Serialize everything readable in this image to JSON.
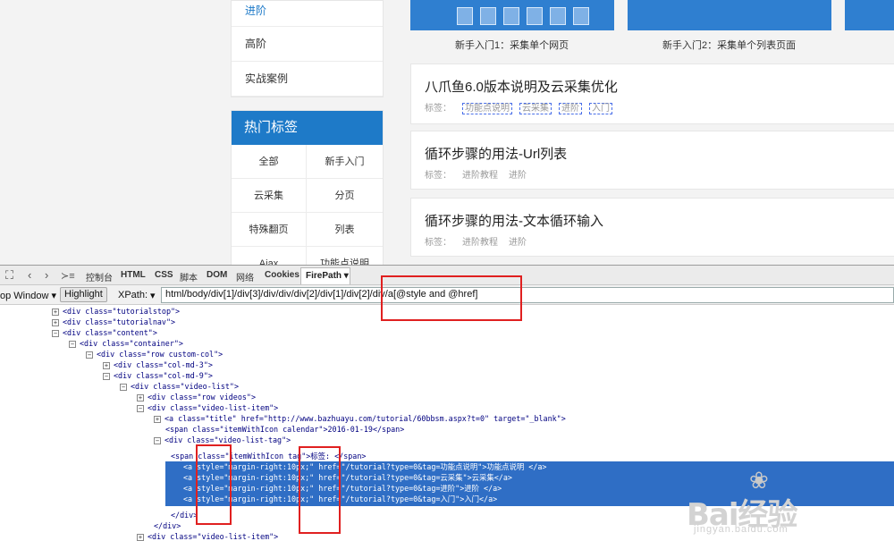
{
  "side_menu": {
    "items": [
      "进阶",
      "高阶",
      "实战案例"
    ]
  },
  "hot_tags": {
    "title": "热门标签",
    "items": [
      "全部",
      "新手入门",
      "云采集",
      "分页",
      "特殊翻页",
      "列表",
      "Ajax",
      "功能点说明"
    ]
  },
  "thumbnails": {
    "captions": [
      "新手入门1：采集单个网页",
      "新手入门2：采集单个列表页面"
    ]
  },
  "articles": [
    {
      "title": "八爪鱼6.0版本说明及云采集优化",
      "tag_label": "标签：",
      "tags": [
        "功能点说明",
        "云采集",
        "进阶",
        "入门"
      ]
    },
    {
      "title": "循环步骤的用法-Url列表",
      "tag_label": "标签：",
      "tags": [
        "进阶教程",
        "进阶"
      ]
    },
    {
      "title": "循环步骤的用法-文本循环输入",
      "tag_label": "标签：",
      "tags": [
        "进阶教程",
        "进阶"
      ]
    }
  ],
  "devtools": {
    "tabs": [
      "控制台",
      "HTML",
      "CSS",
      "脚本",
      "DOM",
      "网络",
      "Cookies"
    ],
    "active_tab": "FirePath ▾",
    "toolbar": {
      "window_select": "op Window ▾",
      "highlight_button": "Highlight",
      "xpath_label": "XPath:",
      "xpath_dropdown": "▾",
      "xpath_value": "html/body/div[1]/div[3]/div/div/div[2]/div[1]/div[2]/div/a[@style and @href]"
    },
    "tree_lines": [
      "<div class=\"tutorialstop\">",
      "<div class=\"tutorialnav\">",
      "<div class=\"content\">",
      "<div class=\"container\">",
      "<div class=\"row custom-col\">",
      "<div class=\"col-md-3\">",
      "<div class=\"col-md-9\">",
      "<div class=\"video-list\">",
      "<div class=\"row videos\">",
      "<div class=\"video-list-item\">",
      "<a class=\"title\" href=\"http://www.bazhuayu.com/tutorial/60bbsm.aspx?t=0\" target=\"_blank\">",
      "<span class=\"itemWithIcon calendar\">2016-01-19</span>",
      "<div class=\"video-list-tag\">",
      "<span class=\"itemWithIcon tag\">标签: </span>",
      "<a style=\"margin-right:10px;\" href=\"/tutorial?type=0&tag=功能点说明\">功能点说明 </a>",
      "<a style=\"margin-right:10px;\" href=\"/tutorial?type=0&tag=云采集\">云采集</a>",
      "<a style=\"margin-right:10px;\" href=\"/tutorial?type=0&tag=进阶\">进阶 </a>",
      "<a style=\"margin-right:10px;\" href=\"/tutorial?type=0&tag=入门\">入门</a>",
      "</div>",
      "</div>",
      "<div class=\"video-list-item\">"
    ]
  },
  "watermark": {
    "brand": "Bai经验",
    "sub": "jingyan.baidu.com"
  }
}
